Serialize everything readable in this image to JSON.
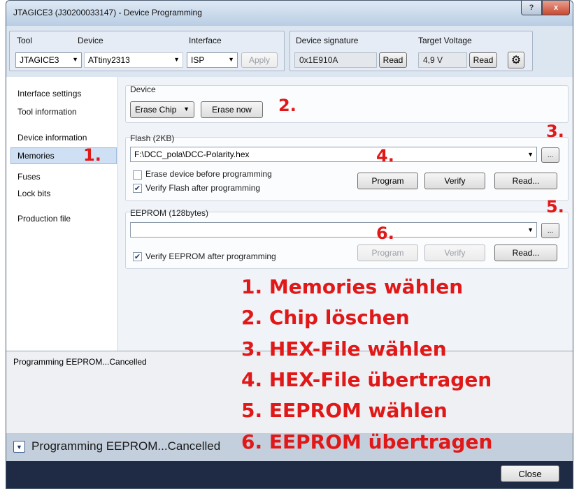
{
  "window": {
    "title": "JTAGICE3 (J30200033147) - Device Programming",
    "help_label": "?",
    "close_label": "x"
  },
  "toolbar": {
    "tool_label": "Tool",
    "tool_value": "JTAGICE3",
    "device_label": "Device",
    "device_value": "ATtiny2313",
    "interface_label": "Interface",
    "interface_value": "ISP",
    "apply_label": "Apply",
    "signature_label": "Device signature",
    "signature_value": "0x1E910A",
    "signature_read": "Read",
    "voltage_label": "Target Voltage",
    "voltage_value": "4,9 V",
    "voltage_read": "Read",
    "settings_icon": "gear-icon"
  },
  "sidebar": {
    "items": [
      {
        "label": "Interface settings"
      },
      {
        "label": "Tool information"
      },
      {
        "label": "Device information"
      },
      {
        "label": "Memories",
        "selected": true
      },
      {
        "label": "Fuses"
      },
      {
        "label": "Lock bits"
      },
      {
        "label": "Production file"
      }
    ]
  },
  "device_section": {
    "caption": "Device",
    "erase_mode": "Erase Chip",
    "erase_now": "Erase now"
  },
  "flash_section": {
    "caption": "Flash (2KB)",
    "file_path": "F:\\DCC_pola\\DCC-Polarity.hex",
    "browse": "...",
    "erase_before": "Erase device before programming",
    "erase_before_checked": false,
    "verify_after": "Verify Flash after programming",
    "verify_after_checked": true,
    "program": "Program",
    "verify": "Verify",
    "read": "Read..."
  },
  "eeprom_section": {
    "caption": "EEPROM (128bytes)",
    "file_path": "",
    "browse": "...",
    "verify_after": "Verify EEPROM after programming",
    "verify_after_checked": true,
    "program": "Program",
    "verify": "Verify",
    "read": "Read..."
  },
  "annotations": {
    "markers": [
      "1.",
      "2.",
      "3.",
      "4.",
      "5.",
      "6."
    ],
    "steps": [
      "1. Memories wählen",
      "2. Chip löschen",
      "3. HEX-File wählen",
      "4. HEX-File übertragen",
      "5. EEPROM wählen",
      "6. EEPROM übertragen"
    ],
    "color": "#e01818"
  },
  "log": {
    "text": "Programming EEPROM...Cancelled"
  },
  "status": {
    "text": "Programming EEPROM...Cancelled",
    "expand_icon": "chevron-down-icon"
  },
  "footer": {
    "close": "Close"
  }
}
